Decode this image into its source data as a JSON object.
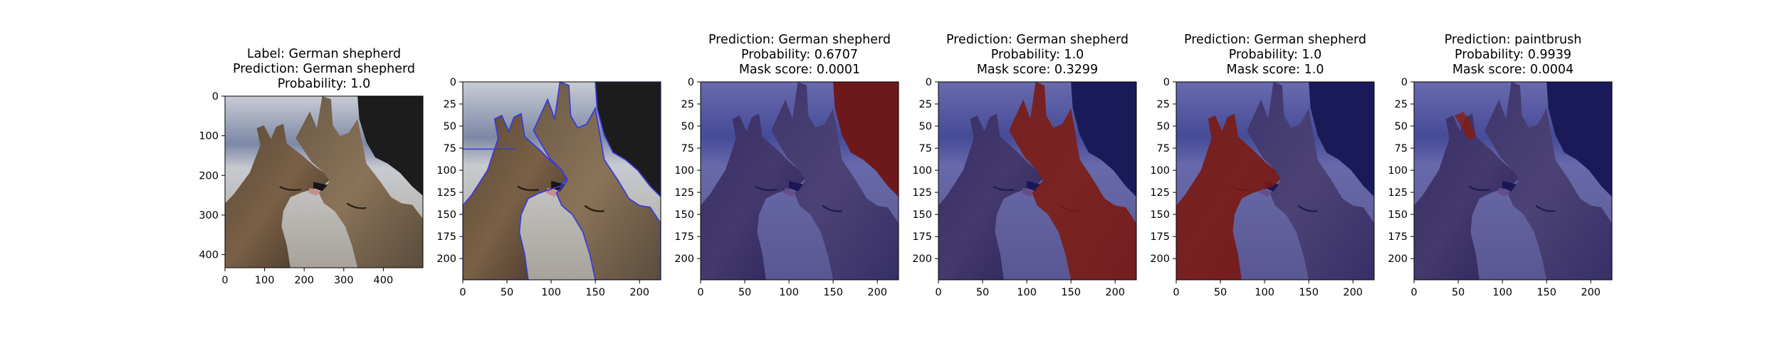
{
  "panels": [
    {
      "title_lines": [
        "Label: German shepherd",
        "Prediction: German shepherd",
        "Probability: 1.0"
      ],
      "image": "original-photo",
      "image_extent": [
        500,
        433
      ],
      "x_ticks": [
        "0",
        "100",
        "200",
        "300",
        "400"
      ],
      "y_ticks": [
        "0",
        "100",
        "200",
        "300",
        "400"
      ]
    },
    {
      "title_lines": [],
      "image": "segmentation-contours",
      "image_extent": [
        224,
        224
      ],
      "x_ticks": [
        "0",
        "50",
        "100",
        "150",
        "200"
      ],
      "y_ticks": [
        "0",
        "25",
        "50",
        "75",
        "100",
        "125",
        "150",
        "175",
        "200"
      ]
    },
    {
      "title_lines": [
        "Prediction: German shepherd",
        "Probability: 0.6707",
        "Mask score: 0.0001"
      ],
      "image": "mask-overlay-background",
      "image_extent": [
        224,
        224
      ],
      "x_ticks": [
        "0",
        "50",
        "100",
        "150",
        "200"
      ],
      "y_ticks": [
        "0",
        "25",
        "50",
        "75",
        "100",
        "125",
        "150",
        "175",
        "200"
      ]
    },
    {
      "title_lines": [
        "Prediction: German shepherd",
        "Probability: 1.0",
        "Mask score: 0.3299"
      ],
      "image": "mask-overlay-right-dog",
      "image_extent": [
        224,
        224
      ],
      "x_ticks": [
        "0",
        "50",
        "100",
        "150",
        "200"
      ],
      "y_ticks": [
        "0",
        "25",
        "50",
        "75",
        "100",
        "125",
        "150",
        "175",
        "200"
      ]
    },
    {
      "title_lines": [
        "Prediction: German shepherd",
        "Probability: 1.0",
        "Mask score: 1.0"
      ],
      "image": "mask-overlay-left-dog",
      "image_extent": [
        224,
        224
      ],
      "x_ticks": [
        "0",
        "50",
        "100",
        "150",
        "200"
      ],
      "y_ticks": [
        "0",
        "25",
        "50",
        "75",
        "100",
        "125",
        "150",
        "175",
        "200"
      ]
    },
    {
      "title_lines": [
        "Prediction: paintbrush",
        "Probability: 0.9939",
        "Mask score: 0.0004"
      ],
      "image": "mask-overlay-ear",
      "image_extent": [
        224,
        224
      ],
      "x_ticks": [
        "0",
        "50",
        "100",
        "150",
        "200"
      ],
      "y_ticks": [
        "0",
        "25",
        "50",
        "75",
        "100",
        "125",
        "150",
        "175",
        "200"
      ]
    }
  ],
  "colors": {
    "mask_blue": "#1a1a8c",
    "mask_red": "#8a1a08",
    "contour_blue": "#3a3ad8"
  }
}
